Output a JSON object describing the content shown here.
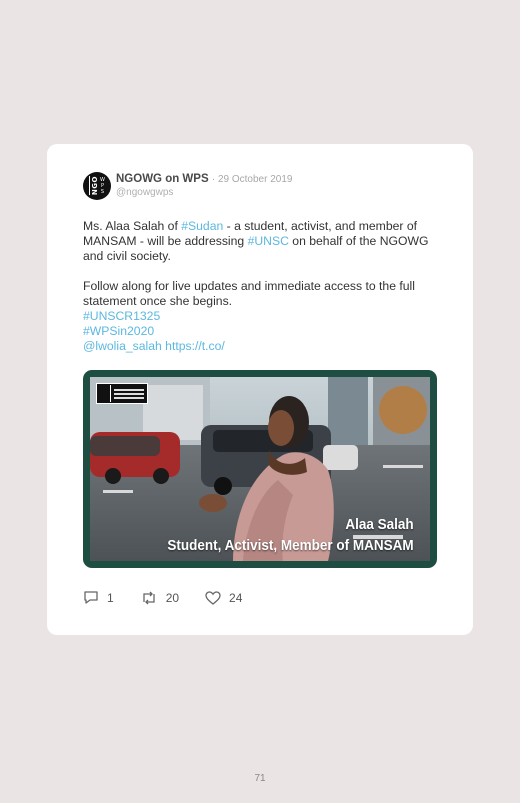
{
  "tweet": {
    "account_name": "NGOWG on WPS",
    "date": "· 29 October 2019",
    "handle": "@ngowgwps",
    "avatar_text_left": "NGO",
    "avatar_text_right": [
      "W",
      "P",
      "S"
    ],
    "paragraph1": {
      "t1": "Ms. Alaa Salah of ",
      "tag1": "#Sudan",
      "t2": " - a student, activist, and member of MANSAM - will be addressing ",
      "tag2": "#UNSC",
      "t3": " on behalf of the NGOWG and civil society."
    },
    "paragraph2": "Follow along for live updates and immediate access to the full statement once she begins.",
    "hashtag_line1": "#UNSCR1325",
    "hashtag_line2": "#WPSin2020",
    "mention": "@lwolia_salah",
    "url": "https://t.co/",
    "media": {
      "caption_name": "Alaa Salah",
      "caption_title": "Student, Activist, Member of MANSAM"
    },
    "actions": {
      "replies": "1",
      "retweets": "20",
      "likes": "24"
    }
  },
  "colors": {
    "page_background": "#ebe4e4",
    "link": "#5bb8e0",
    "media_frame": "#1e4d42"
  },
  "icons": [
    "reply-icon",
    "retweet-icon",
    "like-icon"
  ],
  "page_number": "71"
}
